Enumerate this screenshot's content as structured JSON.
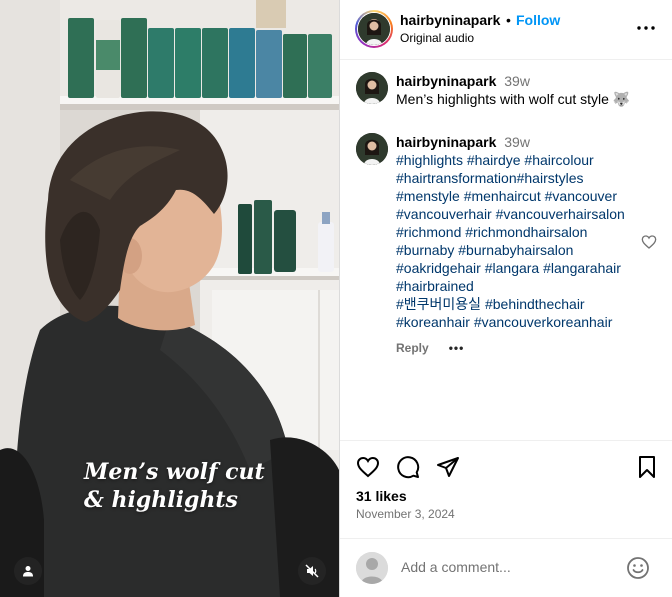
{
  "post": {
    "username": "hairbyninapark",
    "dot": "•",
    "follow_label": "Follow",
    "audio": "Original audio",
    "overlay_caption_line1": "Men’s wolf cut",
    "overlay_caption_line2": "& highlights"
  },
  "comments": [
    {
      "username": "hairbyninapark",
      "time": "39w",
      "text": "Men’s highlights with wolf cut style 🐺"
    },
    {
      "username": "hairbyninapark",
      "time": "39w",
      "tag_lines": [
        "#highlights #hairdye #haircolour",
        "#hairtransformation#hairstyles",
        "#menstyle #menhaircut #vancouver",
        "#vancouverhair #vancouverhairsalon",
        "#richmond #richmondhairsalon",
        "#burnaby #burnabyhairsalon",
        "#oakridgehair #langara #langarahair",
        "#hairbrained",
        "#밴쿠버미용실 #behindthechair",
        "#koreanhair #vancouverkoreanhair"
      ],
      "reply_label": "Reply",
      "more_label": "•••"
    }
  ],
  "engagement": {
    "likes": "31 likes",
    "date": "November 3, 2024"
  },
  "composer": {
    "placeholder": "Add a comment..."
  },
  "icons": {
    "more": "more-horizontal-icon",
    "like": "heart-icon",
    "comment": "comment-bubble-icon",
    "share": "paper-plane-icon",
    "save": "bookmark-icon",
    "emoji": "emoji-icon",
    "user_tag": "user-icon",
    "mute": "speaker-muted-icon"
  },
  "colors": {
    "link": "#0095f6",
    "hashtag": "#00376b",
    "muted_text": "#737373"
  }
}
